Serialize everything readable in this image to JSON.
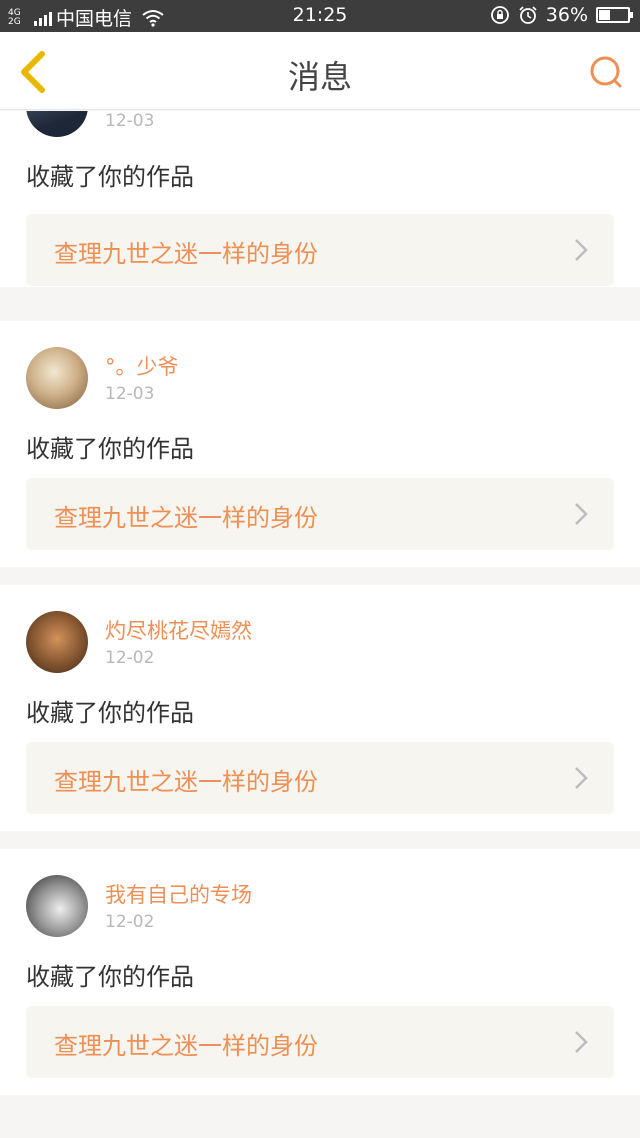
{
  "status_bar": {
    "network_top": "4G",
    "network_bottom": "2G",
    "carrier": "中国电信",
    "time": "21:25",
    "battery": "36%"
  },
  "header": {
    "title": "消息"
  },
  "notifications": [
    {
      "user": "",
      "date": "12-03",
      "action": "收藏了你的作品",
      "work": "查理九世之迷一样的身份",
      "avatar_colors": [
        "#1d2737",
        "#56677c"
      ]
    },
    {
      "user": "°。少爷",
      "date": "12-03",
      "action": "收藏了你的作品",
      "work": "查理九世之迷一样的身份",
      "avatar_colors": [
        "#f1e8d2",
        "#7a5a3a"
      ]
    },
    {
      "user": "灼尽桃花尽嫣然",
      "date": "12-02",
      "action": "收藏了你的作品",
      "work": "查理九世之迷一样的身份",
      "avatar_colors": [
        "#5a3a24",
        "#d4925a"
      ]
    },
    {
      "user": "我有自己的专场",
      "date": "12-02",
      "action": "收藏了你的作品",
      "work": "查理九世之迷一样的身份",
      "avatar_colors": [
        "#eeeeee",
        "#2a2a2a"
      ]
    }
  ],
  "colors": {
    "accent": "#ee8f55",
    "back_arrow": "#e8b800"
  }
}
